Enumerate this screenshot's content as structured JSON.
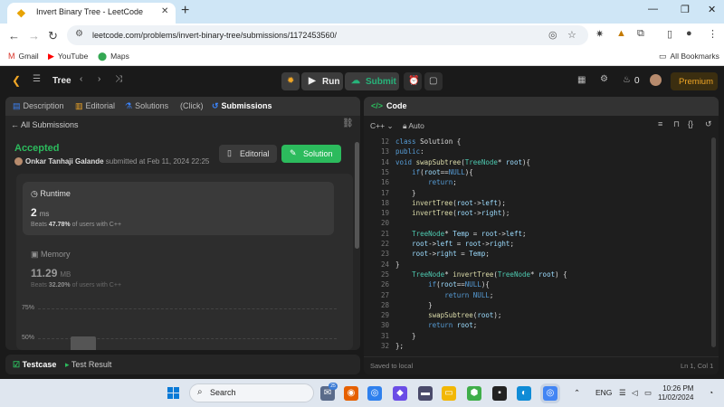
{
  "browser": {
    "tab_title": "Invert Binary Tree - LeetCode",
    "url": "leetcode.com/problems/invert-binary-tree/submissions/1172453560/",
    "bookmarks": [
      {
        "label": "Gmail"
      },
      {
        "label": "YouTube"
      },
      {
        "label": "Maps"
      }
    ],
    "all_bookmarks": "All Bookmarks"
  },
  "lc_header": {
    "problem_list": "Tree",
    "run_label": "Run",
    "submit_label": "Submit",
    "streak": "0",
    "premium_label": "Premium"
  },
  "left_tabs": [
    {
      "label": "Description"
    },
    {
      "label": "Editorial"
    },
    {
      "label": "Solutions"
    },
    {
      "label": "(Click)"
    },
    {
      "label": "Submissions"
    }
  ],
  "submission": {
    "back_label": "All Submissions",
    "status": "Accepted",
    "user": "Onkar Tanhaji Galande",
    "submitted_text": "submitted at Feb 11, 2024 22:25",
    "editorial_btn": "Editorial",
    "solution_btn": "Solution",
    "runtime": {
      "title": "Runtime",
      "value": "2",
      "unit": "ms",
      "beats_prefix": "Beats",
      "beats_pct": "47.78%",
      "beats_suffix": "of users with C++"
    },
    "memory": {
      "title": "Memory",
      "value": "11.29",
      "unit": "MB",
      "beats_prefix": "Beats",
      "beats_pct": "32.20%",
      "beats_suffix": "of users with C++"
    },
    "chart_labels": [
      "75%",
      "50%"
    ]
  },
  "test_panel": {
    "testcase": "Testcase",
    "result": "Test Result"
  },
  "code_panel": {
    "title": "Code",
    "language": "C++",
    "mode": "Auto",
    "saved": "Saved to local",
    "cursor": "Ln 1, Col 1",
    "lines": [
      {
        "n": "12",
        "t": "class Solution {"
      },
      {
        "n": "13",
        "t": "public:"
      },
      {
        "n": "14",
        "t": "void swapSubtree(TreeNode* root){"
      },
      {
        "n": "15",
        "t": "    if(root==NULL){"
      },
      {
        "n": "16",
        "t": "        return;"
      },
      {
        "n": "17",
        "t": "    }"
      },
      {
        "n": "18",
        "t": "    invertTree(root->left);"
      },
      {
        "n": "19",
        "t": "    invertTree(root->right);"
      },
      {
        "n": "20",
        "t": ""
      },
      {
        "n": "21",
        "t": "    TreeNode* Temp = root->left;"
      },
      {
        "n": "22",
        "t": "    root->left = root->right;"
      },
      {
        "n": "23",
        "t": "    root->right = Temp;"
      },
      {
        "n": "24",
        "t": "}"
      },
      {
        "n": "25",
        "t": "    TreeNode* invertTree(TreeNode* root) {"
      },
      {
        "n": "26",
        "t": "        if(root==NULL){"
      },
      {
        "n": "27",
        "t": "            return NULL;"
      },
      {
        "n": "28",
        "t": "        }"
      },
      {
        "n": "29",
        "t": "        swapSubtree(root);"
      },
      {
        "n": "30",
        "t": "        return root;"
      },
      {
        "n": "31",
        "t": "    }"
      },
      {
        "n": "32",
        "t": "};"
      }
    ]
  },
  "taskbar": {
    "search": "Search",
    "chat_badge": "25",
    "lang": "ENG",
    "time": "10:26 PM",
    "date": "11/02/2024"
  },
  "colors": {
    "accepted": "#2cbb5d",
    "premium": "#f0a626",
    "keyword": "#569cd6"
  }
}
